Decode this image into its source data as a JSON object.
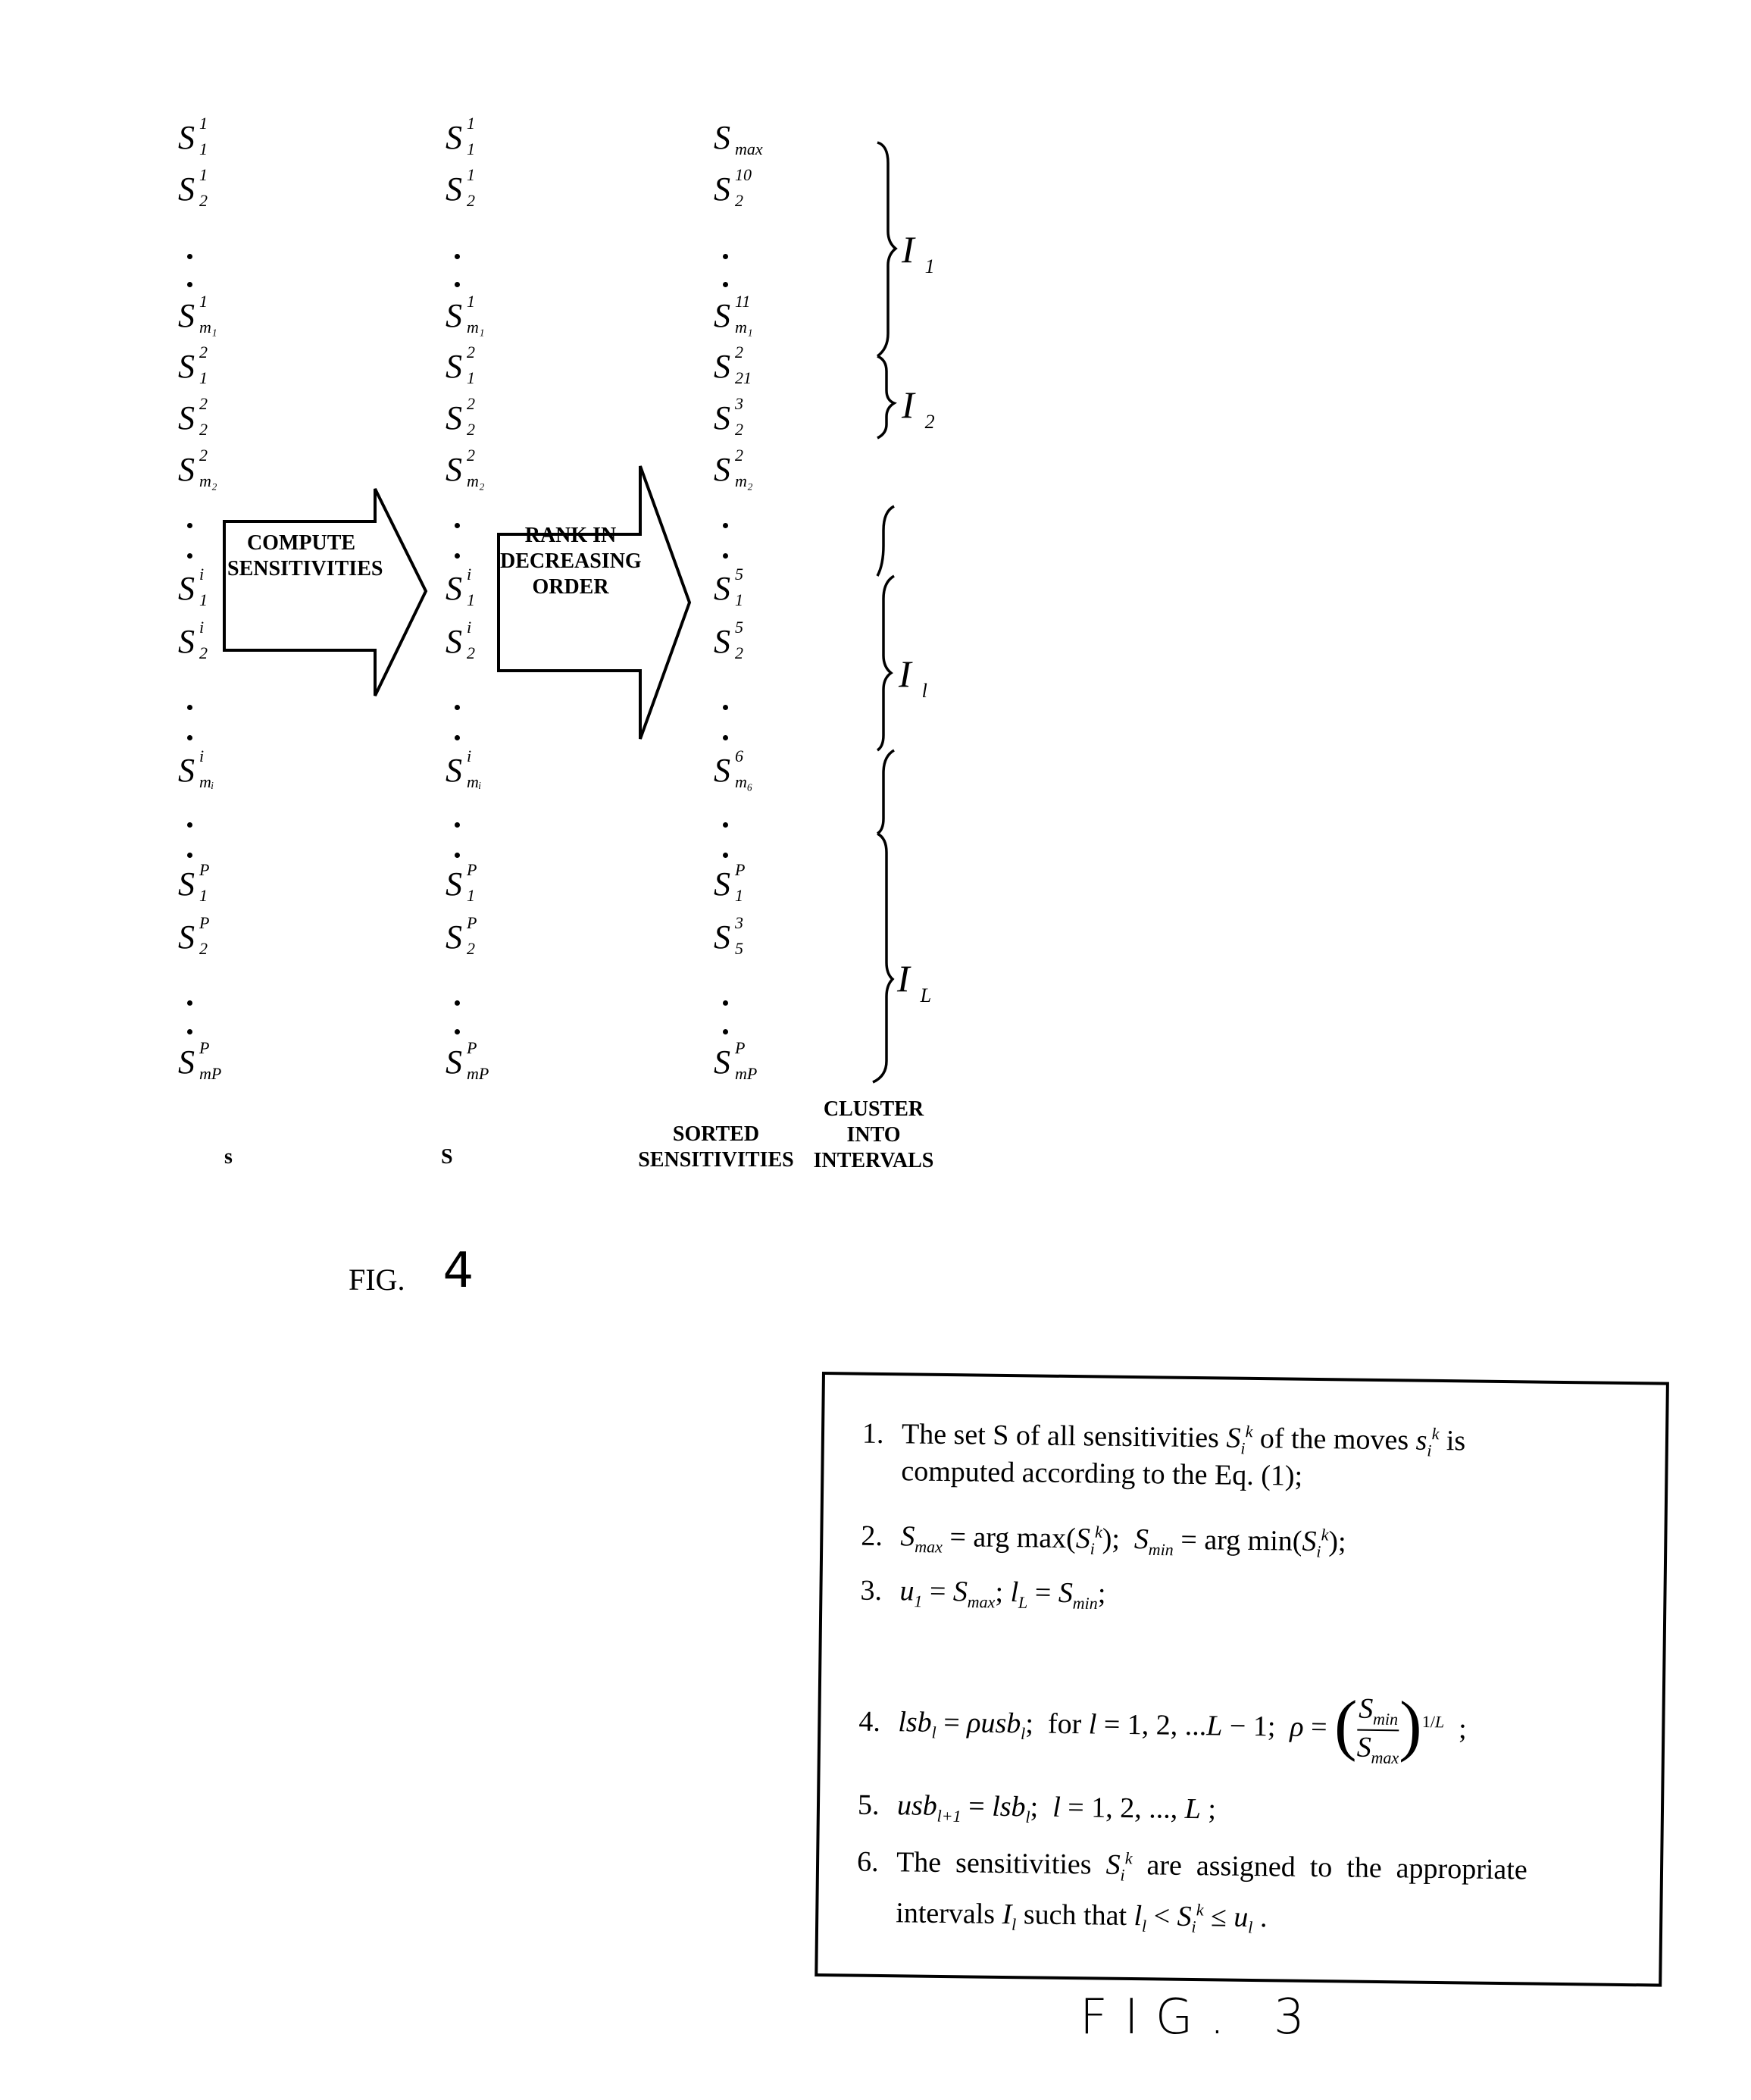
{
  "fig4": {
    "column_raw": {
      "items": [
        {
          "type": "sym",
          "base": "S",
          "sup": "1",
          "sub": "1"
        },
        {
          "type": "sym",
          "base": "S",
          "sup": "1",
          "sub": "2"
        },
        {
          "type": "dot"
        },
        {
          "type": "dot"
        },
        {
          "type": "sym",
          "base": "S",
          "sup": "1",
          "sub": "m₁"
        },
        {
          "type": "sym",
          "base": "S",
          "sup": "2",
          "sub": "1"
        },
        {
          "type": "sym",
          "base": "S",
          "sup": "2",
          "sub": "2"
        },
        {
          "type": "sym",
          "base": "S",
          "sup": "2",
          "sub": "m₂"
        },
        {
          "type": "dot"
        },
        {
          "type": "dot"
        },
        {
          "type": "sym",
          "base": "S",
          "sup": "i",
          "sub": "1"
        },
        {
          "type": "sym",
          "base": "S",
          "sup": "i",
          "sub": "2"
        },
        {
          "type": "dot"
        },
        {
          "type": "dot"
        },
        {
          "type": "sym",
          "base": "S",
          "sup": "i",
          "sub": "mᵢ"
        },
        {
          "type": "dot"
        },
        {
          "type": "dot"
        },
        {
          "type": "sym",
          "base": "S",
          "sup": "P",
          "sub": "1"
        },
        {
          "type": "sym",
          "base": "S",
          "sup": "P",
          "sub": "2"
        },
        {
          "type": "dot"
        },
        {
          "type": "dot"
        },
        {
          "type": "sym",
          "base": "S",
          "sup": "P",
          "sub": "mP"
        }
      ],
      "label": "s"
    },
    "column_computed": {
      "items": [
        {
          "type": "sym",
          "base": "S",
          "sup": "1",
          "sub": "1"
        },
        {
          "type": "sym",
          "base": "S",
          "sup": "1",
          "sub": "2"
        },
        {
          "type": "dot"
        },
        {
          "type": "dot"
        },
        {
          "type": "sym",
          "base": "S",
          "sup": "1",
          "sub": "m₁"
        },
        {
          "type": "sym",
          "base": "S",
          "sup": "2",
          "sub": "1"
        },
        {
          "type": "sym",
          "base": "S",
          "sup": "2",
          "sub": "2"
        },
        {
          "type": "sym",
          "base": "S",
          "sup": "2",
          "sub": "m₂"
        },
        {
          "type": "dot"
        },
        {
          "type": "dot"
        },
        {
          "type": "sym",
          "base": "S",
          "sup": "i",
          "sub": "1"
        },
        {
          "type": "sym",
          "base": "S",
          "sup": "i",
          "sub": "2"
        },
        {
          "type": "dot"
        },
        {
          "type": "dot"
        },
        {
          "type": "sym",
          "base": "S",
          "sup": "i",
          "sub": "mᵢ"
        },
        {
          "type": "dot"
        },
        {
          "type": "dot"
        },
        {
          "type": "sym",
          "base": "S",
          "sup": "P",
          "sub": "1"
        },
        {
          "type": "sym",
          "base": "S",
          "sup": "P",
          "sub": "2"
        },
        {
          "type": "dot"
        },
        {
          "type": "dot"
        },
        {
          "type": "sym",
          "base": "S",
          "sup": "P",
          "sub": "mP"
        }
      ],
      "label": "S"
    },
    "column_sorted": {
      "items": [
        {
          "type": "sym",
          "base": "S",
          "sup": "",
          "sub": "max"
        },
        {
          "type": "sym",
          "base": "S",
          "sup": "10",
          "sub": "2"
        },
        {
          "type": "dot"
        },
        {
          "type": "dot"
        },
        {
          "type": "sym",
          "base": "S",
          "sup": "11",
          "sub": "m₁"
        },
        {
          "type": "sym",
          "base": "S",
          "sup": "2",
          "sub": "21"
        },
        {
          "type": "sym",
          "base": "S",
          "sup": "3",
          "sub": "2"
        },
        {
          "type": "sym",
          "base": "S",
          "sup": "2",
          "sub": "m₂"
        },
        {
          "type": "dot"
        },
        {
          "type": "dot"
        },
        {
          "type": "sym",
          "base": "S",
          "sup": "5",
          "sub": "1"
        },
        {
          "type": "sym",
          "base": "S",
          "sup": "5",
          "sub": "2"
        },
        {
          "type": "dot"
        },
        {
          "type": "dot"
        },
        {
          "type": "sym",
          "base": "S",
          "sup": "6",
          "sub": "m₆"
        },
        {
          "type": "dot"
        },
        {
          "type": "dot"
        },
        {
          "type": "sym",
          "base": "S",
          "sup": "P",
          "sub": "1"
        },
        {
          "type": "sym",
          "base": "S",
          "sup": "3",
          "sub": "5"
        },
        {
          "type": "dot"
        },
        {
          "type": "dot"
        },
        {
          "type": "sym",
          "base": "S",
          "sup": "P",
          "sub": "mP"
        }
      ],
      "label_line1": "SORTED",
      "label_line2": "SENSITIVITIES"
    },
    "arrow_compute": {
      "line1": "COMPUTE",
      "line2": "SENSITIVITIES"
    },
    "arrow_rank": {
      "line1": "RANK IN",
      "line2": "DECREASING",
      "line3": "ORDER"
    },
    "intervals": [
      {
        "name": "I",
        "sub": "1"
      },
      {
        "name": "I",
        "sub": "2"
      },
      {
        "name": "I",
        "sub": "l"
      },
      {
        "name": "I",
        "sub": "L"
      }
    ],
    "cluster_label": {
      "line1": "CLUSTER",
      "line2": "INTO",
      "line3": "INTERVALS"
    },
    "fig_label": "FIG.",
    "fig_number": "4"
  },
  "fig3": {
    "steps": [
      {
        "num": "1.",
        "text_a": "The set S of all sensitivities ",
        "text_b": " of the moves ",
        "text_c": " is",
        "line2": "computed according to the Eq. (1);"
      },
      {
        "num": "2.",
        "text": "S_max = arg max(S_i^k);  S_min = arg min(S_i^k);"
      },
      {
        "num": "3.",
        "text": "u_1 = S_max ; l_L = S_min ;"
      },
      {
        "num": "4.",
        "text": "lsb_l = ρ usb_l ;  for l = 1, 2, ...L − 1;  ρ = (S_min / S_max)^(1/L) ;"
      },
      {
        "num": "5.",
        "text": "usb_(l+1) = lsb_l ;  l = 1, 2, ..., L ;"
      },
      {
        "num": "6.",
        "line1": "The sensitivities S_i^k are assigned to the appropriate",
        "line2": "intervals I_l such that l_l < S_i^k ≤ u_l ."
      }
    ],
    "fig_label": "FIG. 3"
  }
}
